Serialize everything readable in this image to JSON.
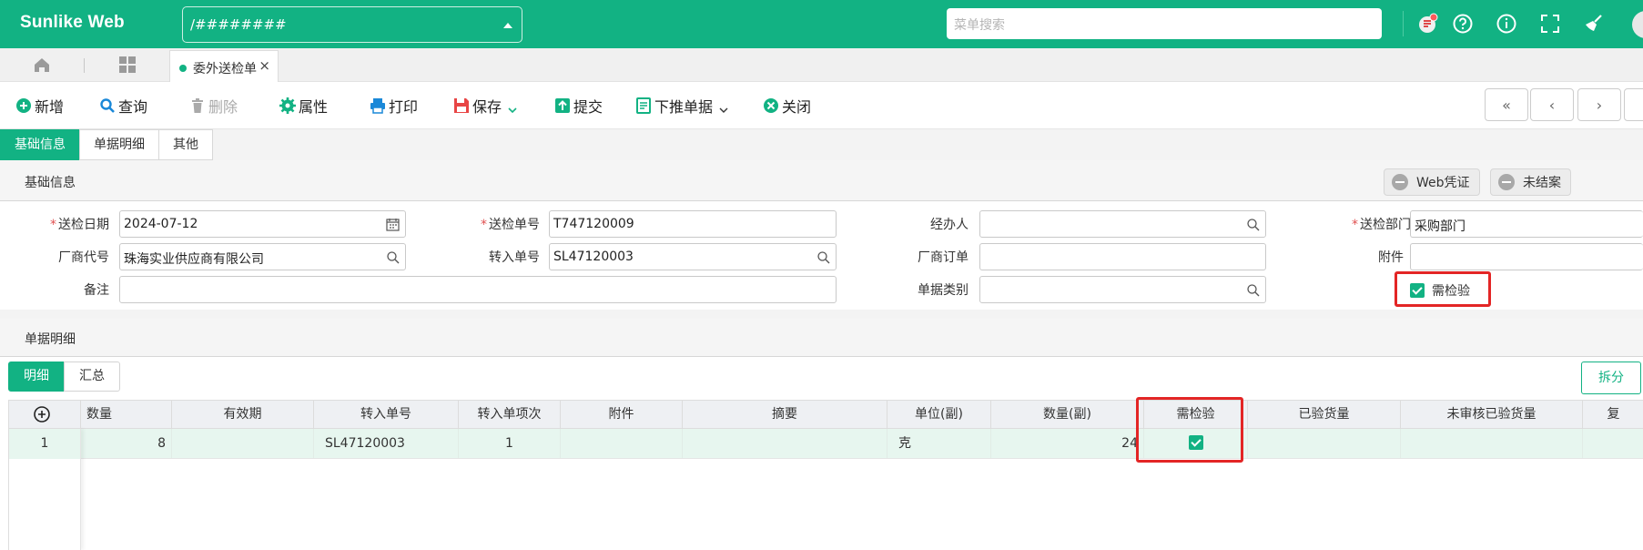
{
  "app": {
    "brand": "Sunlike Web",
    "path_value": "/########",
    "menu_search_placeholder": "菜单搜索",
    "colors": {
      "accent": "#12b283",
      "highlight": "#e32525"
    }
  },
  "tabs": {
    "home_icon": "home-icon",
    "grid_icon": "grid-icon",
    "document_tab": "委外送检单",
    "close_glyph": "×"
  },
  "toolbar": {
    "new": "新增",
    "query": "查询",
    "delete": "删除",
    "properties": "属性",
    "print": "打印",
    "save": "保存",
    "submit": "提交",
    "push_down": "下推单据",
    "close": "关闭",
    "nav": [
      "«",
      "‹",
      "›"
    ]
  },
  "section_tabs": [
    "基础信息",
    "单据明细",
    "其他"
  ],
  "basic_info": {
    "title": "基础信息",
    "web_voucher": "Web凭证",
    "not_closed": "未结案",
    "fields": {
      "inspection_date_label": "送检日期",
      "inspection_date": "2024-07-12",
      "inspection_no_label": "送检单号",
      "inspection_no": "T747120009",
      "handler_label": "经办人",
      "handler": "",
      "dept_label": "送检部门",
      "dept": "采购部门",
      "vendor_label": "厂商代号",
      "vendor": "珠海实业供应商有限公司",
      "transfer_no_label": "转入单号",
      "transfer_no": "SL47120003",
      "vendor_order_label": "厂商订单",
      "vendor_order": "",
      "attachment_label": "附件",
      "attachment": "",
      "remark_label": "备注",
      "remark": "",
      "doc_type_label": "单据类别",
      "doc_type": "",
      "need_inspect_label": "需检验",
      "need_inspect": true
    }
  },
  "detail": {
    "title": "单据明细",
    "sub_tabs": [
      "明细",
      "汇总"
    ],
    "split_button": "拆分",
    "columns": [
      "数量",
      "有效期",
      "转入单号",
      "转入单项次",
      "附件",
      "摘要",
      "单位(副)",
      "数量(副)",
      "需检验",
      "已验货量",
      "未审核已验货量",
      "复"
    ],
    "rows": [
      {
        "row_no": "1",
        "qty": "8",
        "expiry": "",
        "transfer_no": "SL47120003",
        "transfer_item": "1",
        "attachment": "",
        "summary": "",
        "unit_secondary": "克",
        "qty_secondary": "24",
        "need_inspect": true,
        "inspected_qty": "",
        "unreviewed_inspected_qty": ""
      }
    ]
  }
}
